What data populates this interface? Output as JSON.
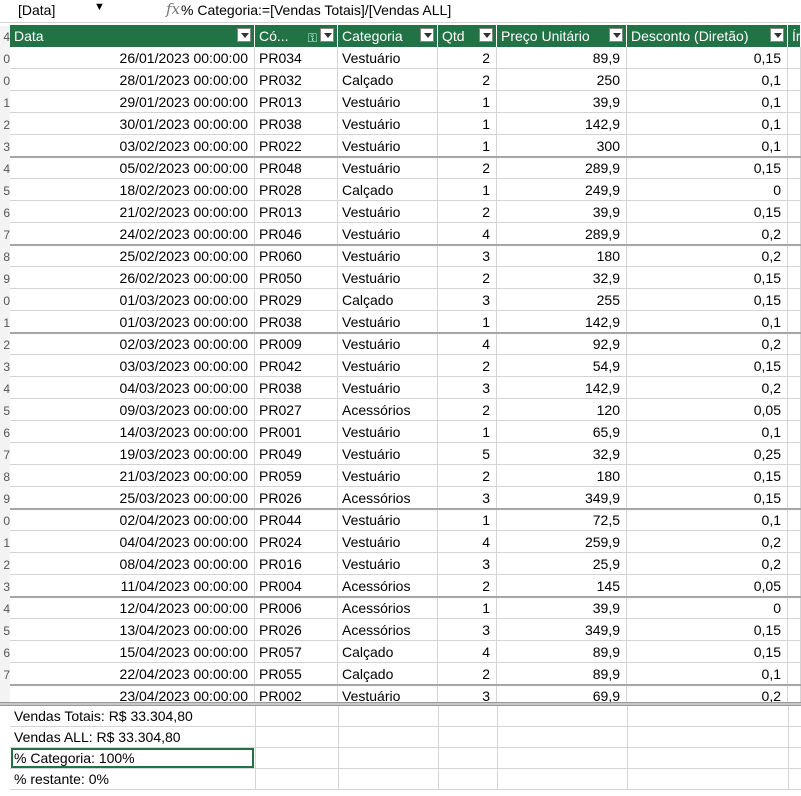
{
  "formula_bar": {
    "name_box": "[Data]",
    "formula": "% Categoria:=[Vendas Totais]/[Vendas ALL]",
    "fx_label": "fx"
  },
  "headers": [
    "Data",
    "Có...",
    "Categoria",
    "Qtd",
    "Preço Unitário",
    "Desconto (Diretão)",
    "Ír"
  ],
  "row_numbers": [
    "4",
    "0",
    "0",
    "1",
    "2",
    "3",
    "4",
    "5",
    "6",
    "7",
    "8",
    "9",
    "0",
    "1",
    "2",
    "3",
    "4",
    "5",
    "6",
    "7",
    "8",
    "9",
    "0",
    "1",
    "2",
    "3",
    "4",
    "5",
    "6",
    "7"
  ],
  "rows": [
    [
      "26/01/2023 00:00:00",
      "PR034",
      "Vestuário",
      "2",
      "89,9",
      "0,15"
    ],
    [
      "28/01/2023 00:00:00",
      "PR032",
      "Calçado",
      "2",
      "250",
      "0,1"
    ],
    [
      "29/01/2023 00:00:00",
      "PR013",
      "Vestuário",
      "1",
      "39,9",
      "0,1"
    ],
    [
      "30/01/2023 00:00:00",
      "PR038",
      "Vestuário",
      "1",
      "142,9",
      "0,1"
    ],
    [
      "03/02/2023 00:00:00",
      "PR022",
      "Vestuário",
      "1",
      "300",
      "0,1"
    ],
    [
      "05/02/2023 00:00:00",
      "PR048",
      "Vestuário",
      "2",
      "289,9",
      "0,15"
    ],
    [
      "18/02/2023 00:00:00",
      "PR028",
      "Calçado",
      "1",
      "249,9",
      "0"
    ],
    [
      "21/02/2023 00:00:00",
      "PR013",
      "Vestuário",
      "2",
      "39,9",
      "0,15"
    ],
    [
      "24/02/2023 00:00:00",
      "PR046",
      "Vestuário",
      "4",
      "289,9",
      "0,2"
    ],
    [
      "25/02/2023 00:00:00",
      "PR060",
      "Vestuário",
      "3",
      "180",
      "0,2"
    ],
    [
      "26/02/2023 00:00:00",
      "PR050",
      "Vestuário",
      "2",
      "32,9",
      "0,15"
    ],
    [
      "01/03/2023 00:00:00",
      "PR029",
      "Calçado",
      "3",
      "255",
      "0,15"
    ],
    [
      "01/03/2023 00:00:00",
      "PR038",
      "Vestuário",
      "1",
      "142,9",
      "0,1"
    ],
    [
      "02/03/2023 00:00:00",
      "PR009",
      "Vestuário",
      "4",
      "92,9",
      "0,2"
    ],
    [
      "03/03/2023 00:00:00",
      "PR042",
      "Vestuário",
      "2",
      "54,9",
      "0,15"
    ],
    [
      "04/03/2023 00:00:00",
      "PR038",
      "Vestuário",
      "3",
      "142,9",
      "0,2"
    ],
    [
      "09/03/2023 00:00:00",
      "PR027",
      "Acessórios",
      "2",
      "120",
      "0,05"
    ],
    [
      "14/03/2023 00:00:00",
      "PR001",
      "Vestuário",
      "1",
      "65,9",
      "0,1"
    ],
    [
      "19/03/2023 00:00:00",
      "PR049",
      "Vestuário",
      "5",
      "32,9",
      "0,25"
    ],
    [
      "21/03/2023 00:00:00",
      "PR059",
      "Vestuário",
      "2",
      "180",
      "0,15"
    ],
    [
      "25/03/2023 00:00:00",
      "PR026",
      "Acessórios",
      "3",
      "349,9",
      "0,15"
    ],
    [
      "02/04/2023 00:00:00",
      "PR044",
      "Vestuário",
      "1",
      "72,5",
      "0,1"
    ],
    [
      "04/04/2023 00:00:00",
      "PR024",
      "Vestuário",
      "4",
      "259,9",
      "0,2"
    ],
    [
      "08/04/2023 00:00:00",
      "PR016",
      "Vestuário",
      "3",
      "25,9",
      "0,2"
    ],
    [
      "11/04/2023 00:00:00",
      "PR004",
      "Acessórios",
      "2",
      "145",
      "0,05"
    ],
    [
      "12/04/2023 00:00:00",
      "PR006",
      "Acessórios",
      "1",
      "39,9",
      "0"
    ],
    [
      "13/04/2023 00:00:00",
      "PR026",
      "Acessórios",
      "3",
      "349,9",
      "0,15"
    ],
    [
      "15/04/2023 00:00:00",
      "PR057",
      "Calçado",
      "4",
      "89,9",
      "0,15"
    ],
    [
      "22/04/2023 00:00:00",
      "PR055",
      "Calçado",
      "2",
      "89,9",
      "0,1"
    ],
    [
      "23/04/2023 00:00:00",
      "PR002",
      "Vestuário",
      "3",
      "69,9",
      "0,2"
    ]
  ],
  "measures": [
    "Vendas Totais: R$ 33.304,80",
    "Vendas ALL: R$ 33.304,80",
    "% Categoria: 100%",
    "% restante: 0%"
  ],
  "colors": {
    "header_bg": "#217346",
    "header_text": "#ffffff",
    "selection": "#217346"
  }
}
